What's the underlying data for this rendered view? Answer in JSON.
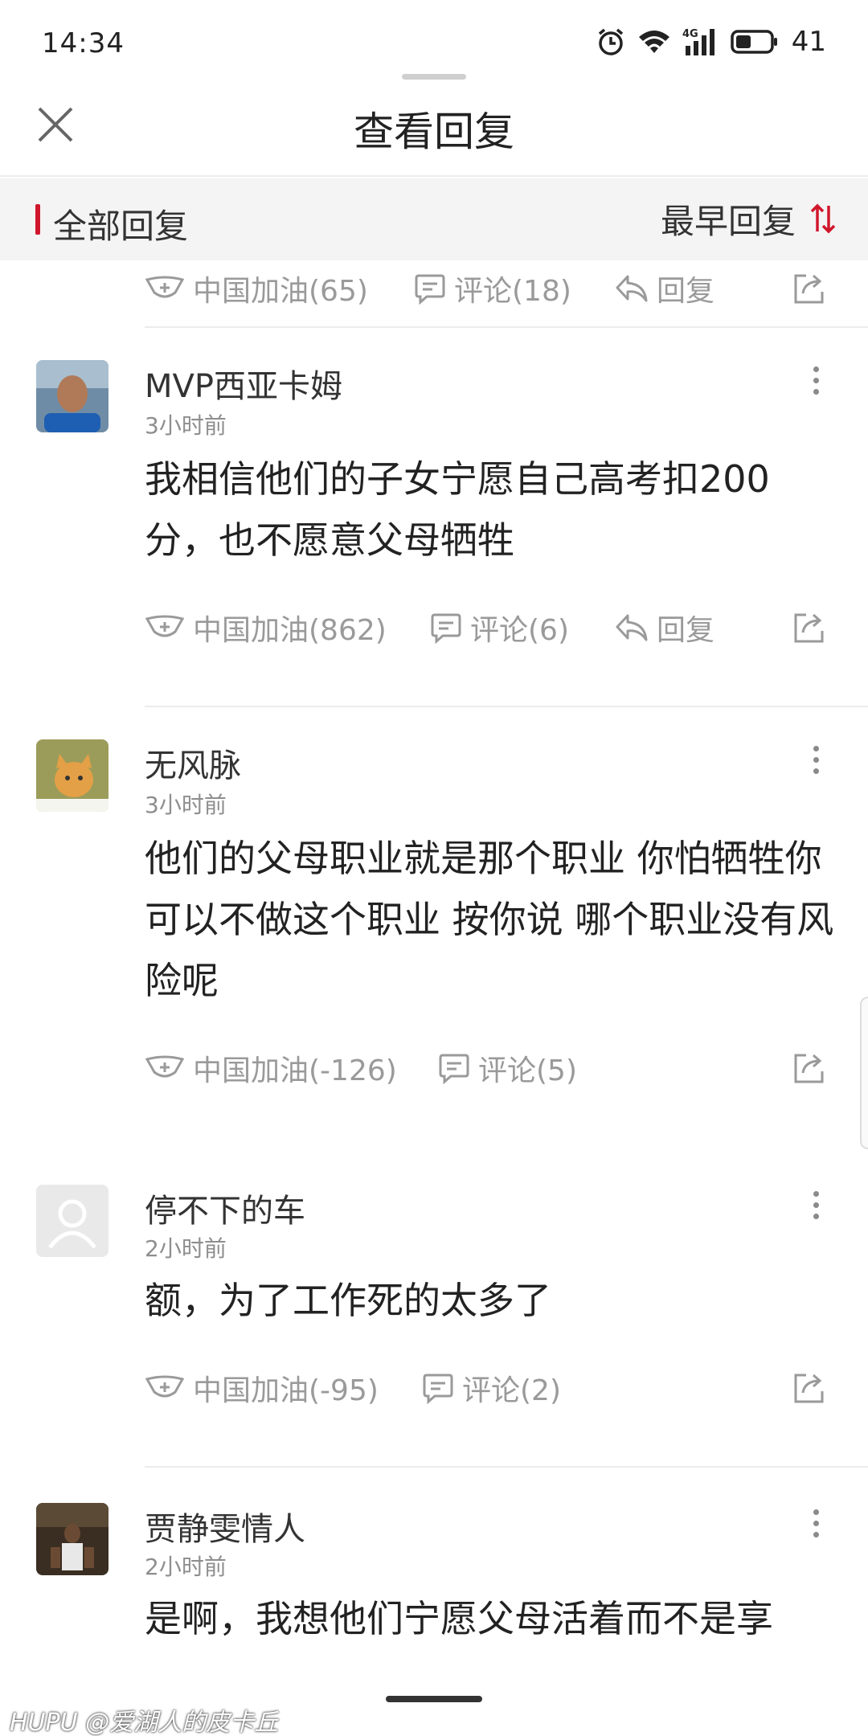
{
  "status_bar": {
    "time": "14:34",
    "network": "4G",
    "battery": "41"
  },
  "header": {
    "title": "查看回复"
  },
  "filter": {
    "label": "全部回复",
    "sort_label": "最早回复"
  },
  "top_actions": {
    "like": "中国加油(65)",
    "comment": "评论(18)",
    "reply": "回复"
  },
  "posts": [
    {
      "username": "MVP西亚卡姆",
      "time": "3小时前",
      "content": "我相信他们的子女宁愿自己高考扣200分，也不愿意父母牺牲",
      "like": "中国加油(862)",
      "comment": "评论(6)",
      "reply": "回复"
    },
    {
      "username": "无风脉",
      "time": "3小时前",
      "content": "他们的父母职业就是那个职业 你怕牺牲你可以不做这个职业 按你说 哪个职业没有风险呢",
      "like": "中国加油(-126)",
      "comment": "评论(5)"
    },
    {
      "username": "停不下的车",
      "time": "2小时前",
      "content": "额，为了工作死的太多了",
      "like": "中国加油(-95)",
      "comment": "评论(2)"
    },
    {
      "username": "贾静雯情人",
      "time": "2小时前",
      "content": "是啊，我想他们宁愿父母活着而不是享"
    }
  ],
  "watermark": "HUPU @爱湖人的皮卡丘",
  "colors": {
    "accent": "#d0162c",
    "meta": "#9a9a9a",
    "divider": "#ececec"
  }
}
